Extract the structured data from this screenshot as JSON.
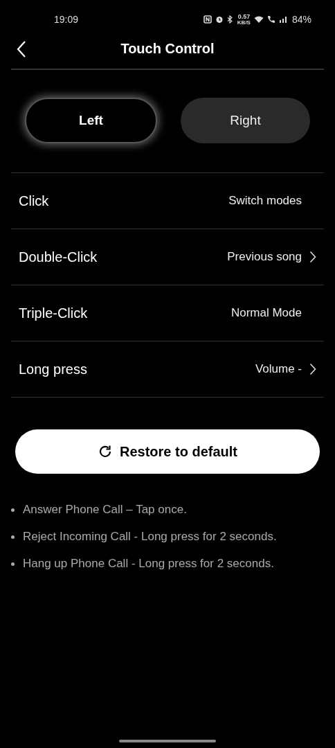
{
  "status_bar": {
    "time": "19:09",
    "speed_value": "0.57",
    "speed_unit": "KB/S",
    "battery": "84%"
  },
  "header": {
    "title": "Touch Control"
  },
  "tabs": [
    {
      "label": "Left",
      "selected": true
    },
    {
      "label": "Right",
      "selected": false
    }
  ],
  "settings": [
    {
      "label": "Click",
      "value": "Switch modes",
      "chevron": false
    },
    {
      "label": "Double-Click",
      "value": "Previous song",
      "chevron": true
    },
    {
      "label": "Triple-Click",
      "value": "Normal Mode",
      "chevron": false
    },
    {
      "label": "Long press",
      "value": "Volume -",
      "chevron": true
    }
  ],
  "restore_button": {
    "label": "Restore to default"
  },
  "notes": [
    "Answer Phone Call – Tap once.",
    "Reject Incoming Call - Long press for 2 seconds.",
    "Hang up Phone Call - Long press for 2 seconds."
  ]
}
